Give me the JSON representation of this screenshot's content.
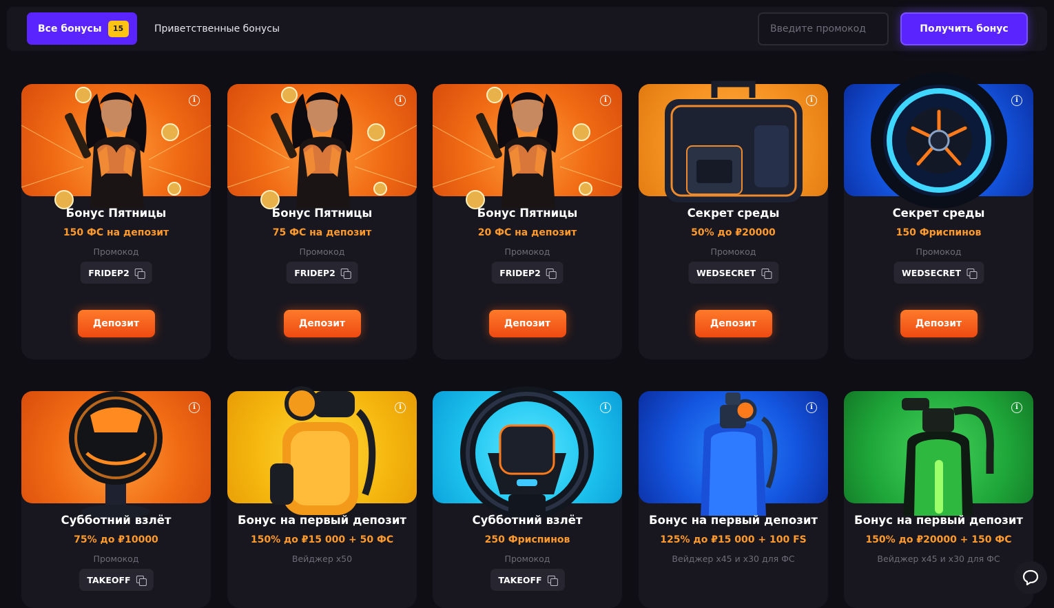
{
  "toolbar": {
    "all_bonuses_label": "Все бонусы",
    "all_bonuses_count": "15",
    "welcome_label": "Приветственные бонусы",
    "promo_placeholder": "Введите промокод",
    "get_bonus_label": "Получить бонус"
  },
  "colors": {
    "accent": "#5a24ff",
    "badge": "#ffc412",
    "highlight_text": "#ff9a2e",
    "deposit_button": "#ee4a12"
  },
  "cards": [
    {
      "title": "Бонус Пятницы",
      "subtitle": "150 ФС на депозит",
      "label": "Промокод",
      "code": "FRIDEP2",
      "button": "Депозит",
      "art": "woman-in-armor",
      "bg": "orange"
    },
    {
      "title": "Бонус Пятницы",
      "subtitle": "75 ФС на депозит",
      "label": "Промокод",
      "code": "FRIDEP2",
      "button": "Депозит",
      "art": "woman-in-armor",
      "bg": "orange"
    },
    {
      "title": "Бонус Пятницы",
      "subtitle": "20 ФС на депозит",
      "label": "Промокод",
      "code": "FRIDEP2",
      "button": "Депозит",
      "art": "woman-in-armor",
      "bg": "orange"
    },
    {
      "title": "Секрет среды",
      "subtitle": "50% до ₽20000",
      "label": "Промокод",
      "code": "WEDSECRET",
      "button": "Депозит",
      "art": "suitcase",
      "bg": "amber"
    },
    {
      "title": "Секрет среды",
      "subtitle": "150 Фриспинов",
      "label": "Промокод",
      "code": "WEDSECRET",
      "button": "Депозит",
      "art": "wheel",
      "bg": "blue"
    },
    {
      "title": "Субботний взлёт",
      "subtitle": "75% до ₽10000",
      "label": "Промокод",
      "code": "TAKEOFF",
      "art": "gear-knob",
      "bg": "orange"
    },
    {
      "title": "Бонус на первый депозит",
      "subtitle": "150% до ₽15 000 + 50 ФС",
      "label": "Вейджер x50",
      "art": "jetpack",
      "bg": "yellow"
    },
    {
      "title": "Субботний взлёт",
      "subtitle": "250 Фриспинов",
      "label": "Промокод",
      "code": "TAKEOFF",
      "art": "steering-wheel",
      "bg": "cyan"
    },
    {
      "title": "Бонус на первый депозит",
      "subtitle": "125% до ₽15 000 + 100 FS",
      "label": "Вейджер x45 и x30 для ФС",
      "art": "gas-tank-blue",
      "bg": "blue"
    },
    {
      "title": "Бонус на первый депозит",
      "subtitle": "150% до ₽20000 + 150 ФС",
      "label": "Вейджер x45 и x30 для ФС",
      "art": "gas-tank-green",
      "bg": "green"
    }
  ]
}
